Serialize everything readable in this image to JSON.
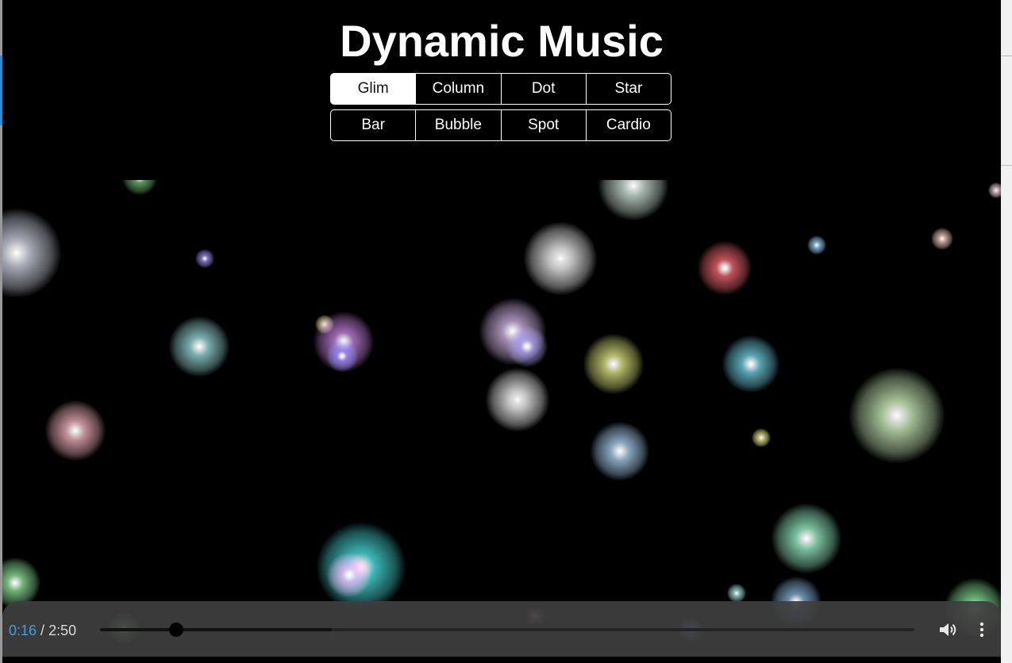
{
  "title": "Dynamic Music",
  "modes": {
    "row1": [
      "Glim",
      "Column",
      "Dot",
      "Star"
    ],
    "row2": [
      "Bar",
      "Bubble",
      "Spot",
      "Cardio"
    ],
    "selected": "Glim"
  },
  "player": {
    "current_time": "0:16",
    "separator": " / ",
    "duration": "2:50",
    "progress_fraction": 0.094,
    "buffered_fraction": 0.285,
    "volume_icon": "volume-icon",
    "more_icon": "more-options-icon"
  },
  "colors": {
    "background": "#000000",
    "text": "#ffffff",
    "accent_time": "#3aa0e0"
  }
}
